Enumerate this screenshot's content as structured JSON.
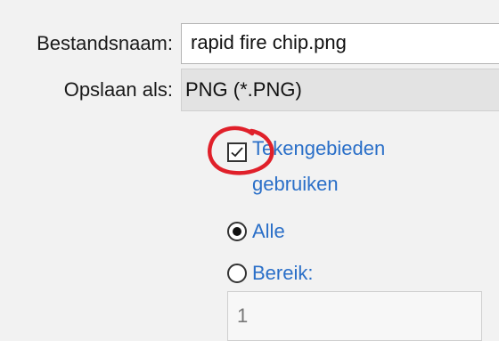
{
  "dialog": {
    "filename_label": "Bestandsnaam:",
    "filename_value": "rapid fire chip.png",
    "saveas_label": "Opslaan als:",
    "saveas_value": "PNG (*.PNG)"
  },
  "options": {
    "artboards_checkbox": {
      "line1": "Tekengebieden",
      "line2": "gebruiken",
      "checked": true
    },
    "radio_all": {
      "label": "Alle",
      "selected": true
    },
    "radio_range": {
      "label": "Bereik:",
      "selected": false
    },
    "range_value": "1"
  },
  "annotation": {
    "color": "#e0202a",
    "shape": "hand-drawn-circle"
  },
  "colors": {
    "link_blue": "#2a6fc8"
  }
}
